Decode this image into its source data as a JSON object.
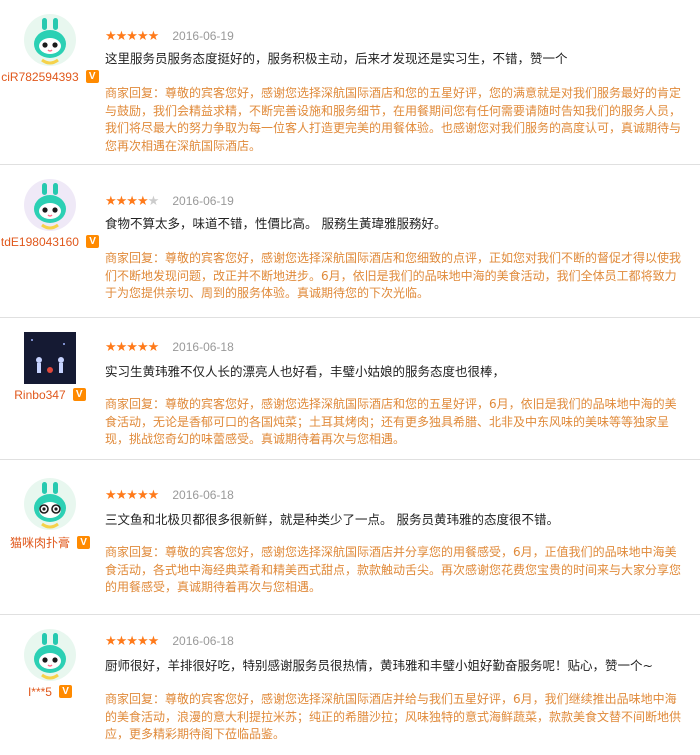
{
  "colors": {
    "star": "#ff7a1a",
    "username": "#e0581c",
    "reply": "#e08a3a",
    "badge": "#ff8a00"
  },
  "reviews": [
    {
      "username": "ciR782594393",
      "badge": "V",
      "rating": 5,
      "stars_text": "★★★★★",
      "date": "2016-06-19",
      "content": "这里服务员服务态度挺好的，服务积极主动，后来才发现还是实习生，不错，赞一个",
      "reply": "商家回复：尊敬的宾客您好，感谢您选择深航国际酒店和您的五星好评，您的满意就是对我们服务最好的肯定与鼓励，我们会精益求精，不断完善设施和服务细节，在用餐期间您有任何需要请随时告知我们的服务人员，我们将尽最大的努力争取为每一位客人打造更完美的用餐体验。也感谢您对我们服务的高度认可，真诚期待与您再次相遇在深航国际酒店。"
    },
    {
      "username": "tdE198043160",
      "badge": "V",
      "rating": 4,
      "stars_text": "★★★★",
      "stars_off": "★",
      "date": "2016-06-19",
      "content": "食物不算太多，味道不错，性價比高。 服務生黃瑋雅服務好。",
      "reply": "商家回复：尊敬的宾客您好，感谢您选择深航国际酒店和您细致的点评，正如您对我们不断的督促才得以使我们不断地发现问题，改正并不断地进步。6月，依旧是我们的品味地中海的美食活动，我们全体员工都将致力于为您提供亲切、周到的服务体验。真诚期待您的下次光临。"
    },
    {
      "username": "Rinbo347",
      "badge": "V",
      "rating": 5,
      "stars_text": "★★★★★",
      "date": "2016-06-18",
      "content": "实习生黄玮雅不仅人长的漂亮人也好看，丰璧小姑娘的服务态度也很棒，",
      "reply": "商家回复：尊敬的宾客您好，感谢您选择深航国际酒店和您的五星好评，6月，依旧是我们的品味地中海的美食活动，无论是香郁可口的各国炖菜；土耳其烤肉；还有更多独具希腊、北非及中东风味的美味等等独家呈现，挑战您奇幻的味蕾感受。真诚期待着再次与您相遇。"
    },
    {
      "username": "猫咪肉扑膏",
      "badge": "V",
      "rating": 5,
      "stars_text": "★★★★★",
      "date": "2016-06-18",
      "content": "三文鱼和北极贝都很多很新鲜，就是种类少了一点。 服务员黄玮雅的态度很不错。",
      "reply": "商家回复：尊敬的宾客您好，感谢您选择深航国际酒店并分享您的用餐感受，6月，正值我们的品味地中海美食活动，各式地中海经典菜肴和精美西式甜点，款款触动舌尖。再次感谢您花费您宝贵的时间来与大家分享您的用餐感受，真诚期待着再次与您相遇。"
    },
    {
      "username": "I***5",
      "badge": "V",
      "rating": 5,
      "stars_text": "★★★★★",
      "date": "2016-06-18",
      "content": "厨师很好，羊排很好吃，特别感谢服务员很热情，黄玮雅和丰璧小姐好勤奋服务呢！贴心，赞一个~",
      "reply": "商家回复：尊敬的宾客您好，感谢您选择深航国际酒店并给与我们五星好评，6月，我们继续推出品味地中海的美食活动，浪漫的意大利提拉米苏；纯正的希腊沙拉；风味独特的意式海鲜蔬菜，款款美食文替不间断地供应，更多精彩期待阁下莅临品鉴。"
    }
  ]
}
